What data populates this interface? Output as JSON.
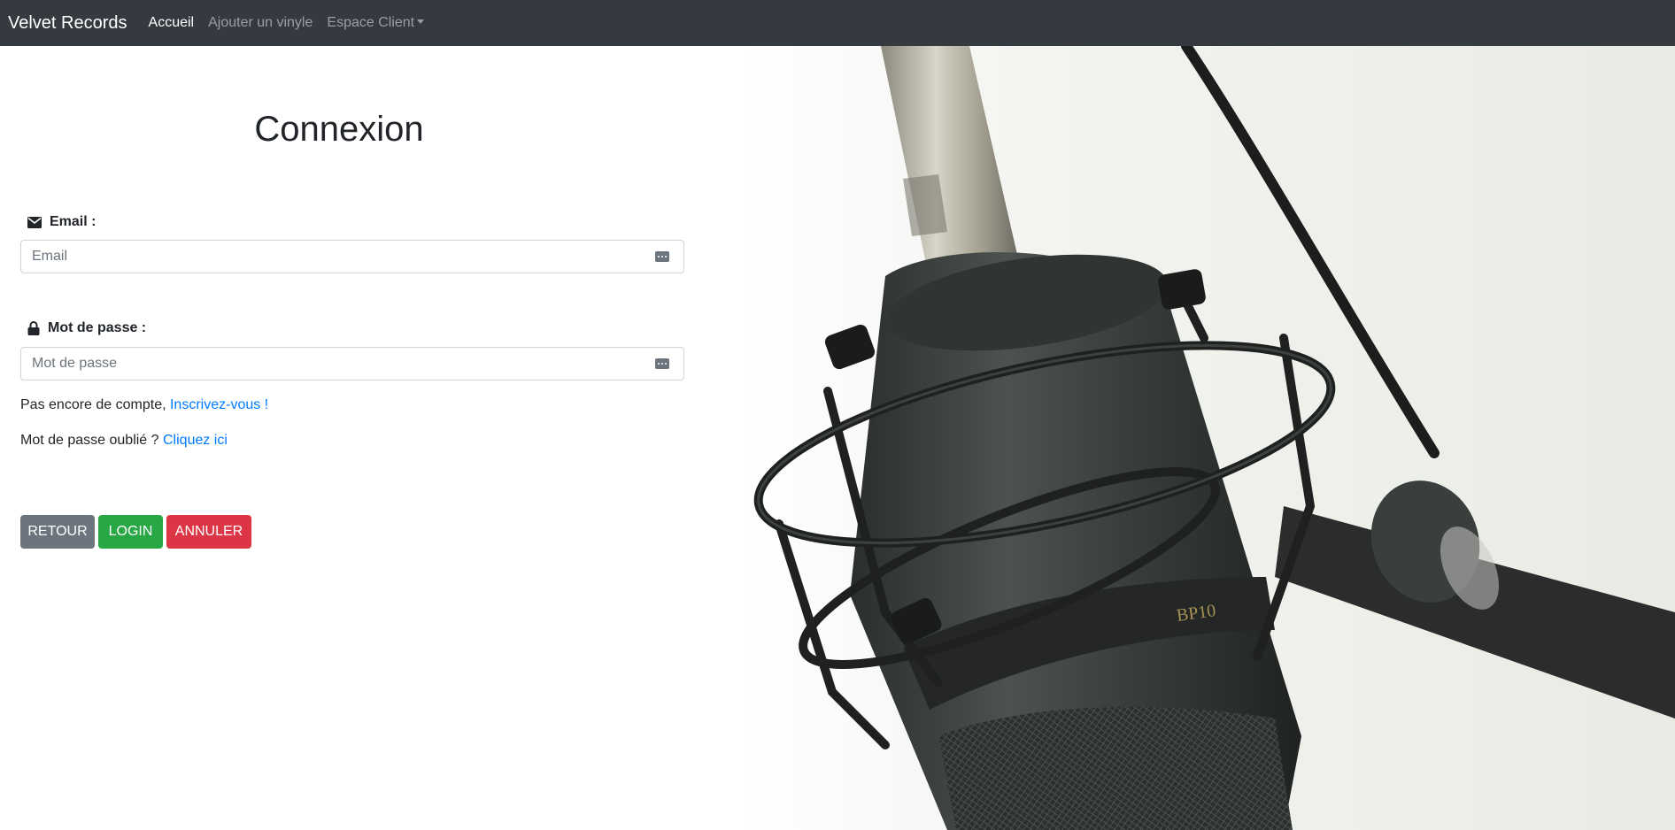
{
  "navbar": {
    "brand": "Velvet Records",
    "links": [
      {
        "label": "Accueil",
        "active": true
      },
      {
        "label": "Ajouter un vinyle",
        "active": false
      },
      {
        "label": "Espace Client",
        "active": false,
        "dropdown": true
      }
    ]
  },
  "form": {
    "title": "Connexion",
    "email": {
      "label": "Email :",
      "placeholder": "Email",
      "value": "",
      "icon": "envelope-icon"
    },
    "password": {
      "label": "Mot de passe :",
      "placeholder": "Mot de passe",
      "value": "",
      "icon": "lock-icon"
    },
    "signup": {
      "text": "Pas encore de compte, ",
      "link": "Inscrivez-vous !"
    },
    "forgot": {
      "text": "Mot de passe oublié ? ",
      "link": "Cliquez ici"
    },
    "buttons": {
      "back": "RETOUR",
      "login": "LOGIN",
      "cancel": "ANNULER"
    }
  },
  "hero": {
    "subject": "studio-microphone-photo",
    "mic_text": "BP10"
  },
  "colors": {
    "navbar": "#343a40",
    "link": "#007bff",
    "secondary": "#6c757d",
    "success": "#28a745",
    "danger": "#dc3545"
  }
}
